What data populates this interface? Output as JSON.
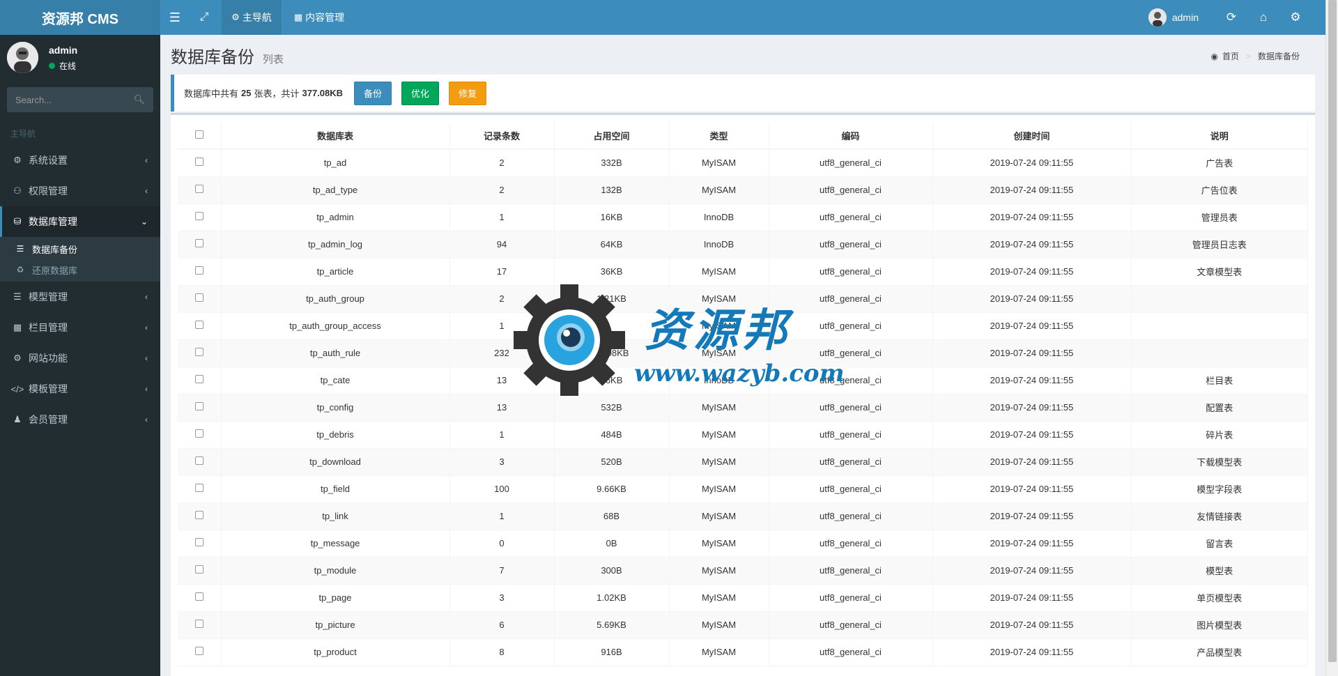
{
  "header": {
    "logo": "资源邦 CMS",
    "tabs": [
      {
        "label": "主导航",
        "icon": "gear-icon"
      },
      {
        "label": "内容管理",
        "icon": "grid-icon"
      }
    ],
    "user": "admin"
  },
  "sidebar": {
    "user_name": "admin",
    "status": "在线",
    "search_placeholder": "Search...",
    "section_label": "主导航",
    "items": [
      {
        "label": "系统设置",
        "icon": "gears-icon"
      },
      {
        "label": "权限管理",
        "icon": "users-icon"
      },
      {
        "label": "数据库管理",
        "icon": "database-icon",
        "active": true,
        "children": [
          {
            "label": "数据库备份",
            "icon": "list-icon",
            "active": true
          },
          {
            "label": "还原数据库",
            "icon": "recycle-icon"
          }
        ]
      },
      {
        "label": "模型管理",
        "icon": "list-icon"
      },
      {
        "label": "栏目管理",
        "icon": "th-icon"
      },
      {
        "label": "网站功能",
        "icon": "gear-icon"
      },
      {
        "label": "模板管理",
        "icon": "code-icon"
      },
      {
        "label": "会员管理",
        "icon": "user-icon"
      }
    ]
  },
  "page": {
    "title": "数据库备份",
    "subtitle": "列表",
    "breadcrumb": [
      "首页",
      "数据库备份"
    ]
  },
  "summary": {
    "prefix": "数据库中共有",
    "table_count": "25",
    "middle": "张表，共计",
    "total_size": "377.08KB",
    "buttons": {
      "backup": "备份",
      "optimize": "优化",
      "repair": "修复"
    }
  },
  "table": {
    "columns": [
      "数据库表",
      "记录条数",
      "占用空间",
      "类型",
      "编码",
      "创建时间",
      "说明"
    ],
    "rows": [
      [
        "tp_ad",
        "2",
        "332B",
        "MyISAM",
        "utf8_general_ci",
        "2019-07-24 09:11:55",
        "广告表"
      ],
      [
        "tp_ad_type",
        "2",
        "132B",
        "MyISAM",
        "utf8_general_ci",
        "2019-07-24 09:11:55",
        "广告位表"
      ],
      [
        "tp_admin",
        "1",
        "16KB",
        "InnoDB",
        "utf8_general_ci",
        "2019-07-24 09:11:55",
        "管理员表"
      ],
      [
        "tp_admin_log",
        "94",
        "64KB",
        "InnoDB",
        "utf8_general_ci",
        "2019-07-24 09:11:55",
        "管理员日志表"
      ],
      [
        "tp_article",
        "17",
        "36KB",
        "MyISAM",
        "utf8_general_ci",
        "2019-07-24 09:11:55",
        "文章模型表"
      ],
      [
        "tp_auth_group",
        "2",
        "1.21KB",
        "MyISAM",
        "utf8_general_ci",
        "2019-07-24 09:11:55",
        ""
      ],
      [
        "tp_auth_group_access",
        "1",
        "",
        "MyISAM",
        "utf8_general_ci",
        "2019-07-24 09:11:55",
        ""
      ],
      [
        "tp_auth_rule",
        "232",
        "17.08KB",
        "MyISAM",
        "utf8_general_ci",
        "2019-07-24 09:11:55",
        ""
      ],
      [
        "tp_cate",
        "13",
        "16KB",
        "InnoDB",
        "utf8_general_ci",
        "2019-07-24 09:11:55",
        "栏目表"
      ],
      [
        "tp_config",
        "13",
        "532B",
        "MyISAM",
        "utf8_general_ci",
        "2019-07-24 09:11:55",
        "配置表"
      ],
      [
        "tp_debris",
        "1",
        "484B",
        "MyISAM",
        "utf8_general_ci",
        "2019-07-24 09:11:55",
        "碎片表"
      ],
      [
        "tp_download",
        "3",
        "520B",
        "MyISAM",
        "utf8_general_ci",
        "2019-07-24 09:11:55",
        "下载模型表"
      ],
      [
        "tp_field",
        "100",
        "9.66KB",
        "MyISAM",
        "utf8_general_ci",
        "2019-07-24 09:11:55",
        "模型字段表"
      ],
      [
        "tp_link",
        "1",
        "68B",
        "MyISAM",
        "utf8_general_ci",
        "2019-07-24 09:11:55",
        "友情链接表"
      ],
      [
        "tp_message",
        "0",
        "0B",
        "MyISAM",
        "utf8_general_ci",
        "2019-07-24 09:11:55",
        "留言表"
      ],
      [
        "tp_module",
        "7",
        "300B",
        "MyISAM",
        "utf8_general_ci",
        "2019-07-24 09:11:55",
        "模型表"
      ],
      [
        "tp_page",
        "3",
        "1.02KB",
        "MyISAM",
        "utf8_general_ci",
        "2019-07-24 09:11:55",
        "单页模型表"
      ],
      [
        "tp_picture",
        "6",
        "5.69KB",
        "MyISAM",
        "utf8_general_ci",
        "2019-07-24 09:11:55",
        "图片模型表"
      ],
      [
        "tp_product",
        "8",
        "916B",
        "MyISAM",
        "utf8_general_ci",
        "2019-07-24 09:11:55",
        "产品模型表"
      ]
    ]
  },
  "watermark": {
    "text": "资源邦",
    "url": "www.wazyb.com"
  }
}
